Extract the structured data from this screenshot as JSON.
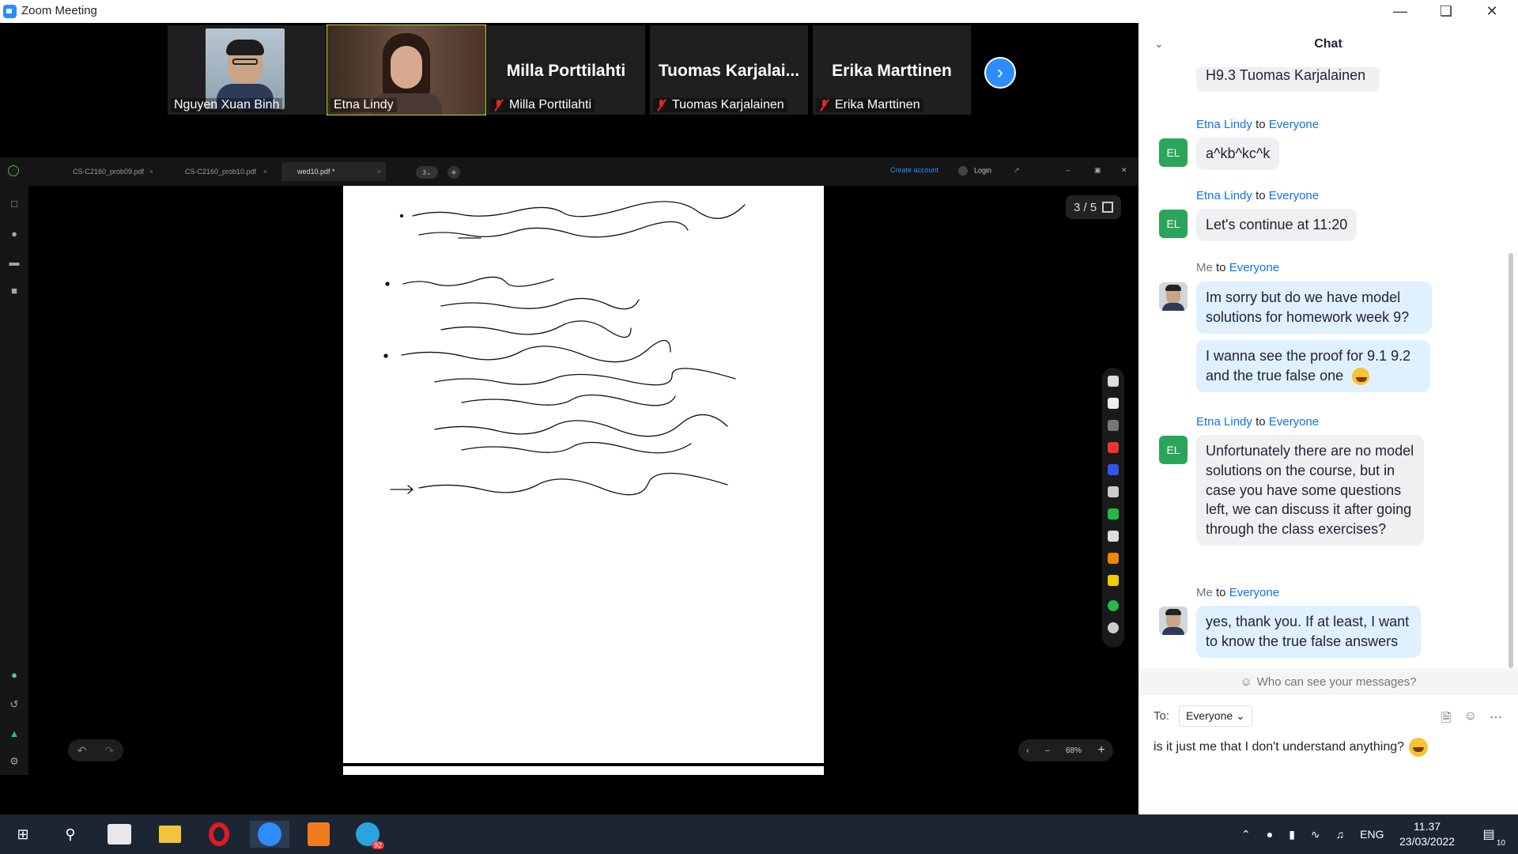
{
  "window": {
    "title": "Zoom Meeting"
  },
  "participants": [
    {
      "name": "Nguyen Xuan Binh",
      "has_video": true
    },
    {
      "name": "Etna Lindy",
      "has_video": true,
      "active_speaker": true
    },
    {
      "name": "Milla Porttilahti",
      "display": "Milla Porttilahti",
      "muted": true
    },
    {
      "name": "Tuomas Karjalainen",
      "display": "Tuomas  Karjalai...",
      "muted": true
    },
    {
      "name": "Erika Marttinen",
      "display": "Erika Marttinen",
      "muted": true
    }
  ],
  "pdf_viewer": {
    "tabs": [
      "CS-C2160_prob09.pdf",
      "CS-C2160_prob10.pdf",
      "wed10.pdf *"
    ],
    "tab_count_badge": "3",
    "create_account": "Create account",
    "login": "Login",
    "page_counter": "3 / 5",
    "zoom_level": "68%"
  },
  "chat": {
    "title": "Chat",
    "overflow_line": "H9.3 Tuomas Karjalainen",
    "messages": [
      {
        "from": "Etna Lindy",
        "to": "Everyone",
        "initials": "EL",
        "text": "a^kb^kc^k"
      },
      {
        "from": "Etna Lindy",
        "to": "Everyone",
        "initials": "EL",
        "text": "Let's continue at 11:20"
      },
      {
        "from": "Me",
        "to": "Everyone",
        "text": "Im sorry but do we have model solutions for homework week 9?"
      },
      {
        "from": "Me",
        "to": "Everyone",
        "text": "I wanna see the proof for 9.1 9.2 and the true false one"
      },
      {
        "from": "Etna Lindy",
        "to": "Everyone",
        "initials": "EL",
        "text": "Unfortunately there are no model solutions on the course, but in case you have some questions left, we can discuss it after going through the class exercises?"
      },
      {
        "from": "Me",
        "to": "Everyone",
        "text": "yes, thank you. If at least, I want to know the true false answers"
      }
    ],
    "sender_me": "Me",
    "to_word": "to",
    "visibility_note": "Who can see your messages?",
    "to_label": "To:",
    "recipient": "Everyone",
    "draft": "is it just me that I don't understand anything?"
  },
  "taskbar": {
    "language": "ENG",
    "time": "11.37",
    "date": "23/03/2022",
    "notification_count": "10",
    "telegram_badge": "92"
  }
}
